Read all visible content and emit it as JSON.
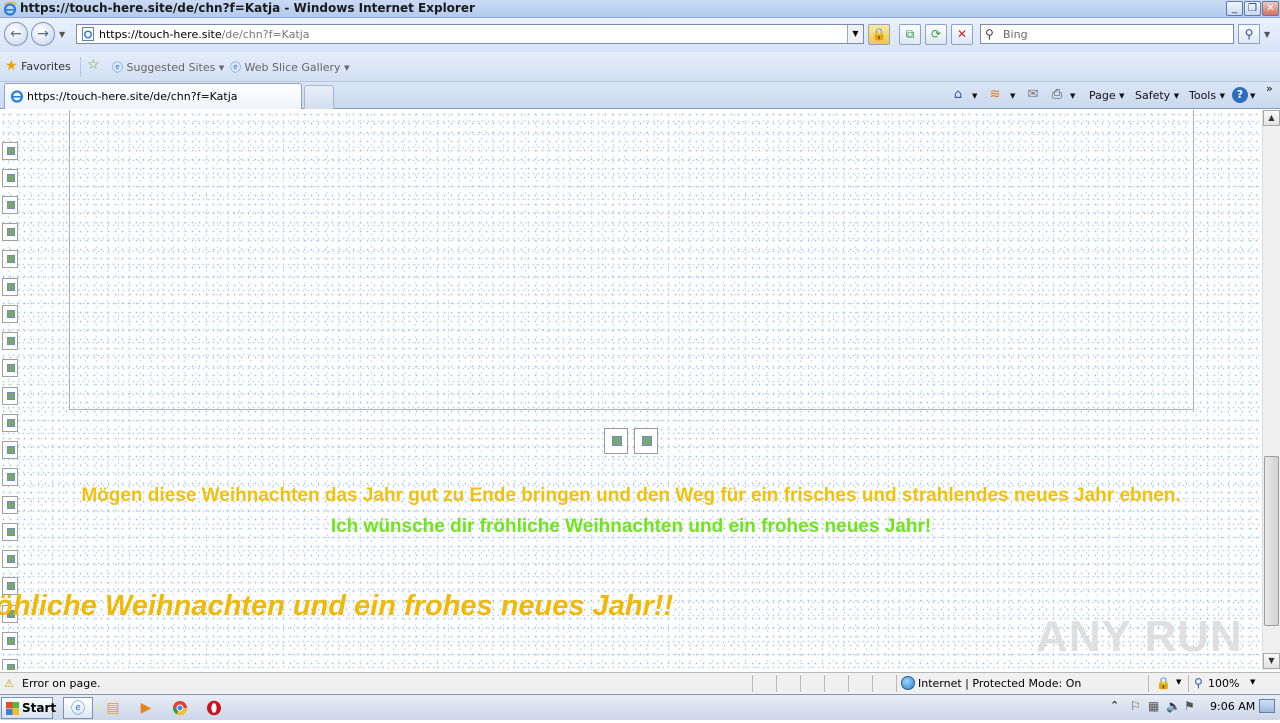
{
  "window": {
    "title": "https://touch-here.site/de/chn?f=Katja - Windows Internet Explorer",
    "minimize": "_",
    "restore": "❐",
    "close": "✕"
  },
  "address_bar": {
    "url_main": "https://touch-here.site",
    "url_path": "/de/chn?f=Katja",
    "search_placeholder": "Bing"
  },
  "favorites_bar": {
    "favorites_label": "Favorites",
    "suggested_sites_label": "Suggested Sites",
    "web_slice_gallery_label": "Web Slice Gallery"
  },
  "tabs": [
    {
      "label": "https://touch-here.site/de/chn?f=Katja",
      "active": true
    }
  ],
  "command_bar": {
    "page_label": "Page",
    "safety_label": "Safety",
    "tools_label": "Tools"
  },
  "page": {
    "line1": "Mögen diese Weihnachten das Jahr gut zu Ende bringen und den Weg für ein frisches und strahlendes neues Jahr ebnen.",
    "line2": "Ich wünsche dir fröhliche Weihnachten und ein frohes neues Jahr!",
    "marquee": "röhliche Weihnachten und ein frohes neues Jahr!!",
    "watermark": "ANY RUN",
    "colors": {
      "line1": "#f2c10a",
      "line2": "#6ee61a",
      "marquee": "#f0b90a"
    }
  },
  "status_bar": {
    "message": "Error on page.",
    "zone": "Internet | Protected Mode: On",
    "zoom": "100%"
  },
  "taskbar": {
    "start_label": "Start",
    "apps": [
      "internet-explorer",
      "file-explorer",
      "media-player",
      "chrome",
      "opera"
    ],
    "clock": "9:06 AM"
  }
}
